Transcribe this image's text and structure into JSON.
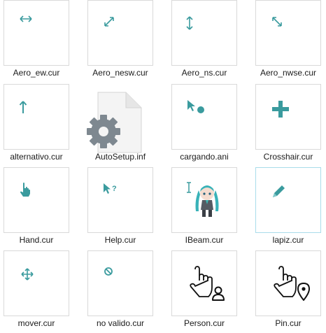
{
  "files": [
    {
      "name": "Aero_ew.cur",
      "icon": "horizontal-resize-cursor-icon"
    },
    {
      "name": "Aero_nesw.cur",
      "icon": "diagonal-resize-nesw-cursor-icon"
    },
    {
      "name": "Aero_ns.cur",
      "icon": "vertical-resize-cursor-icon"
    },
    {
      "name": "Aero_nwse.cur",
      "icon": "diagonal-resize-nwse-cursor-icon"
    },
    {
      "name": "alternativo.cur",
      "icon": "up-arrow-cursor-icon"
    },
    {
      "name": "AutoSetup.inf",
      "icon": "settings-file-icon"
    },
    {
      "name": "cargando.ani",
      "icon": "busy-pointer-cursor-icon"
    },
    {
      "name": "Crosshair.cur",
      "icon": "crosshair-cursor-icon"
    },
    {
      "name": "Hand.cur",
      "icon": "hand-cursor-icon"
    },
    {
      "name": "Help.cur",
      "icon": "help-cursor-icon"
    },
    {
      "name": "IBeam.cur",
      "icon": "ibeam-character-cursor-icon"
    },
    {
      "name": "lapiz.cur",
      "icon": "pencil-cursor-icon"
    },
    {
      "name": "mover.cur",
      "icon": "move-cursor-icon"
    },
    {
      "name": "no valido.cur",
      "icon": "unavailable-cursor-icon"
    },
    {
      "name": "Person.cur",
      "icon": "person-select-cursor-icon"
    },
    {
      "name": "Pin.cur",
      "icon": "location-select-cursor-icon"
    }
  ],
  "selected": "lapiz.cur",
  "colors": {
    "cursor_teal": "#3a9b9e",
    "selection_border": "#a9dcea",
    "thumb_border": "#d9d9d9"
  }
}
